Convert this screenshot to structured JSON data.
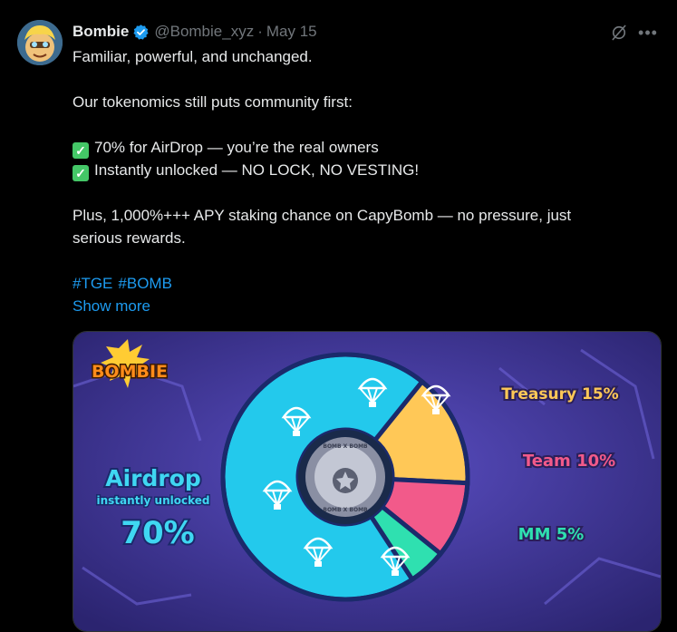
{
  "tweet": {
    "author_name": "Bombie",
    "handle": "@Bombie_xyz",
    "separator": "·",
    "date": "May 15",
    "more_label": "•••",
    "text": {
      "line1": "Familiar, powerful, and unchanged.",
      "line2": "Our tokenomics still puts community first:",
      "check1": "✓",
      "bullet1": "70% for AirDrop — you’re the real owners",
      "check2": "✓",
      "bullet2": "Instantly unlocked — NO LOCK, NO VESTING!",
      "line3": "Plus, 1,000%+++ APY staking chance on CapyBomb — no pressure, just",
      "line4": "serious rewards."
    },
    "hashtags": [
      "#TGE",
      "#BOMB"
    ],
    "show_more": "Show more"
  },
  "media": {
    "logo_text": "BOMBIE",
    "airdrop_title": "Airdrop",
    "airdrop_subtitle": "instantly unlocked",
    "airdrop_percent": "70%",
    "treasury_label": "Treasury 15%",
    "team_label": "Team 10%",
    "mm_label": "MM 5%",
    "center_text_top": "BOMB X BOMB",
    "center_text_bottom": "BOMB X BOMB"
  },
  "chart_data": {
    "type": "pie",
    "categories": [
      "Airdrop",
      "Treasury",
      "Team",
      "MM"
    ],
    "values": [
      70,
      15,
      10,
      5
    ],
    "colors": [
      "#23c9ec",
      "#ffc857",
      "#f25a8a",
      "#2fe0b0"
    ]
  },
  "colors": {
    "accent": "#1d9bf0",
    "verified": "#1d9bf0",
    "background": "#000000"
  }
}
